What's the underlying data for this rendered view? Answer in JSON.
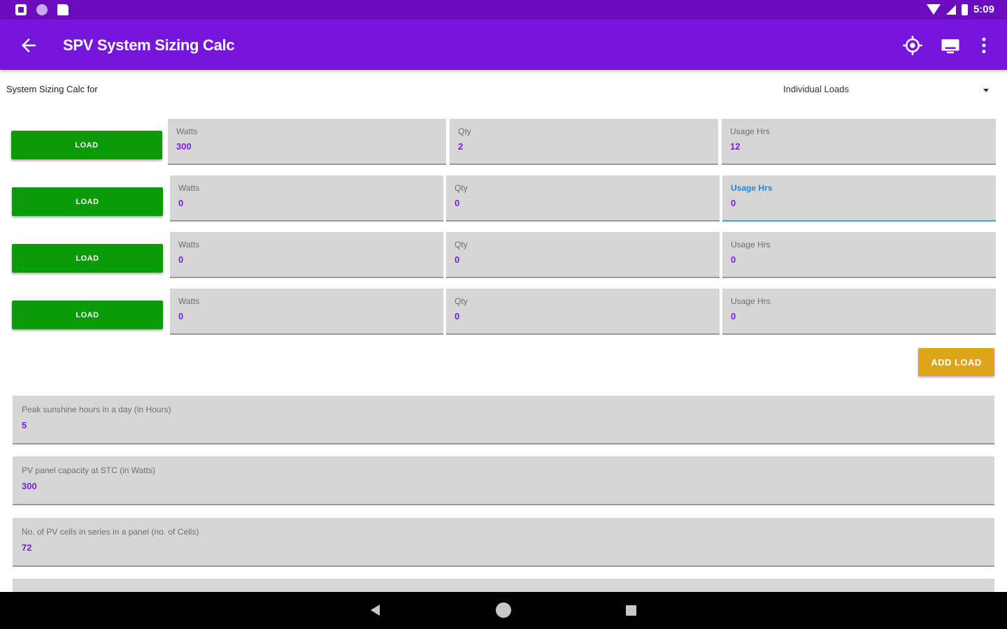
{
  "status_bar": {
    "time": "5:09"
  },
  "app_bar": {
    "title": "SPV System Sizing Calc"
  },
  "calc_for": {
    "label": "System Sizing Calc for",
    "selected": "Individual Loads"
  },
  "loads": [
    {
      "button": "LOAD",
      "watts_label": "Watts",
      "watts": "300",
      "qty_label": "Qty",
      "qty": "2",
      "hours_label": "Usage Hrs",
      "hours": "12"
    },
    {
      "button": "LOAD",
      "watts_label": "Watts",
      "watts": "0",
      "qty_label": "Qty",
      "qty": "0",
      "hours_label": "Usage Hrs",
      "hours": "0"
    },
    {
      "button": "LOAD",
      "watts_label": "Watts",
      "watts": "0",
      "qty_label": "Qty",
      "qty": "0",
      "hours_label": "Usage Hrs",
      "hours": "0"
    },
    {
      "button": "LOAD",
      "watts_label": "Watts",
      "watts": "0",
      "qty_label": "Qty",
      "qty": "0",
      "hours_label": "Usage Hrs",
      "hours": "0"
    }
  ],
  "add_load": "ADD LOAD",
  "params": [
    {
      "label": "Peak sunshine hours in a day (in Hours)",
      "value": "5"
    },
    {
      "label": "PV panel capacity at STC (in Watts)",
      "value": "300"
    },
    {
      "label": "No. of PV cells in series in a panel (no. of Cells)",
      "value": "72"
    }
  ],
  "colors": {
    "status_bar": "#6a0dbf",
    "app_bar": "#7616dc",
    "load_button": "#0a9a0a",
    "add_load_button": "#dca51a",
    "value_text": "#7b1fd6",
    "focus": "#1e88e5"
  }
}
